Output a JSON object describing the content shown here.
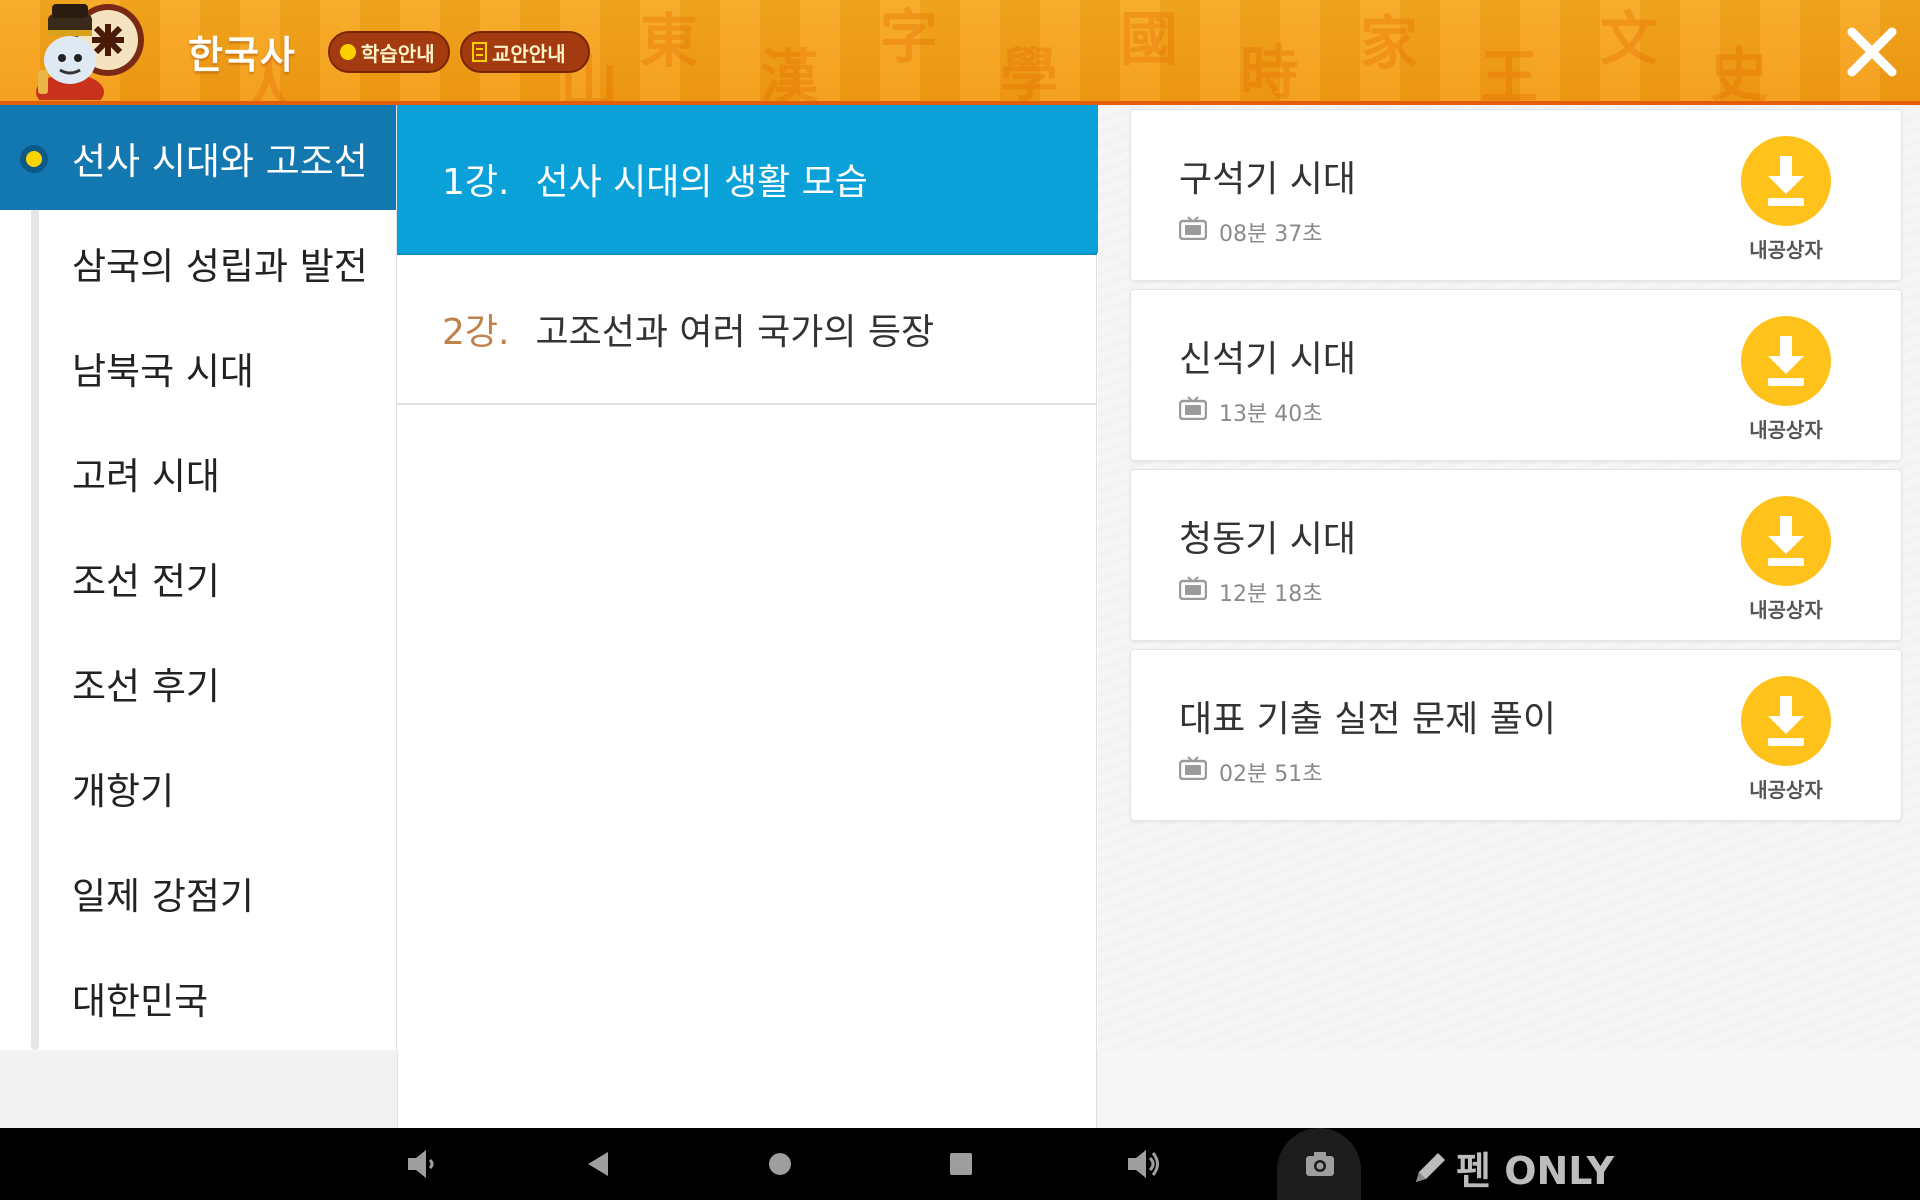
{
  "header": {
    "title": "한국사",
    "study_guide": "학습안내",
    "lesson_guide": "교안안내",
    "background_hanja": [
      "東",
      "漢",
      "字",
      "學",
      "國",
      "時",
      "家",
      "王",
      "文",
      "史",
      "人",
      "山"
    ]
  },
  "chapters": [
    {
      "label": "선사 시대와 고조선",
      "active": true
    },
    {
      "label": "삼국의 성립과 발전",
      "active": false
    },
    {
      "label": "남북국 시대",
      "active": false
    },
    {
      "label": "고려 시대",
      "active": false
    },
    {
      "label": "조선 전기",
      "active": false
    },
    {
      "label": "조선 후기",
      "active": false
    },
    {
      "label": "개항기",
      "active": false
    },
    {
      "label": "일제 강점기",
      "active": false
    },
    {
      "label": "대한민국",
      "active": false
    }
  ],
  "lectures": [
    {
      "num": "1강.",
      "title": "선사 시대의 생활 모습",
      "active": true
    },
    {
      "num": "2강.",
      "title": "고조선과 여러 국가의 등장",
      "active": false
    }
  ],
  "videos": [
    {
      "title": "구석기 시대",
      "duration": "08분 37초",
      "download_label": "내공상자"
    },
    {
      "title": "신석기 시대",
      "duration": "13분 40초",
      "download_label": "내공상자"
    },
    {
      "title": "청동기 시대",
      "duration": "12분 18초",
      "download_label": "내공상자"
    },
    {
      "title": "대표 기출 실전 문제 풀이",
      "duration": "02분 51초",
      "download_label": "내공상자"
    }
  ],
  "navbar": {
    "pen_only": "펜 ONLY"
  },
  "colors": {
    "header_orange": "#f5a623",
    "chapter_active": "#1377b0",
    "lecture_active": "#0aa1d9",
    "download_yellow": "#ffc21a"
  }
}
